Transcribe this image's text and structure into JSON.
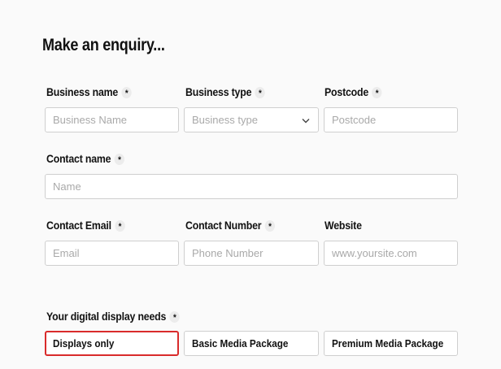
{
  "form": {
    "title": "Make an enquiry...",
    "required_mark": "*",
    "fields": {
      "business_name": {
        "label": "Business name",
        "placeholder": "Business Name"
      },
      "business_type": {
        "label": "Business type",
        "placeholder": "Business type"
      },
      "postcode": {
        "label": "Postcode",
        "placeholder": "Postcode"
      },
      "contact_name": {
        "label": "Contact name",
        "placeholder": "Name"
      },
      "contact_email": {
        "label": "Contact Email",
        "placeholder": "Email"
      },
      "contact_number": {
        "label": "Contact Number",
        "placeholder": "Phone Number"
      },
      "website": {
        "label": "Website",
        "placeholder": "www.yoursite.com"
      }
    },
    "display_needs": {
      "label": "Your digital display needs",
      "options": [
        "Displays only",
        "Basic Media Package",
        "Premium Media Package"
      ],
      "selected": "Displays only"
    }
  },
  "colors": {
    "selected_border": "#d92b2b",
    "field_border": "#cfcfcf",
    "required_badge": "#ececec"
  },
  "icons": {
    "select_indicator": "chevron-down-icon"
  }
}
